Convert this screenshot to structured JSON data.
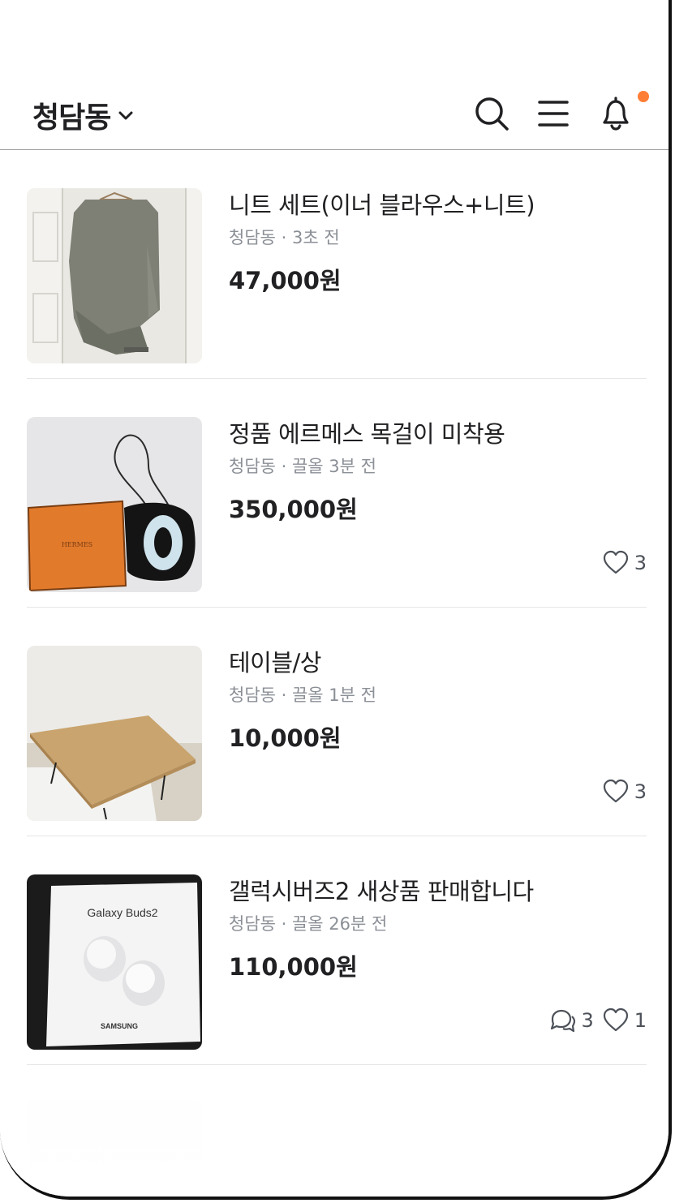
{
  "header": {
    "location": "청담동",
    "icons": [
      "chevron-down-icon",
      "search-icon",
      "menu-icon",
      "bell-icon"
    ],
    "notification_dot_color": "#ff7e36"
  },
  "items": [
    {
      "title": "니트 세트(이너 블라우스+니트)",
      "meta": "청담동 · 3초 전",
      "price": "47,000원",
      "chats": "",
      "likes": ""
    },
    {
      "title": "정품 에르메스 목걸이 미착용",
      "meta": "청담동 · 끌올 3분 전",
      "price": "350,000원",
      "chats": "",
      "likes": "3"
    },
    {
      "title": "테이블/상",
      "meta": "청담동 · 끌올 1분 전",
      "price": "10,000원",
      "chats": "",
      "likes": "3"
    },
    {
      "title": "갤럭시버즈2 새상품 판매합니다",
      "meta": "청담동 · 끌올 26분 전",
      "price": "110,000원",
      "chats": "3",
      "likes": "1",
      "thumb_text": {
        "brand": "Galaxy Buds2",
        "maker": "SAMSUNG"
      }
    }
  ]
}
